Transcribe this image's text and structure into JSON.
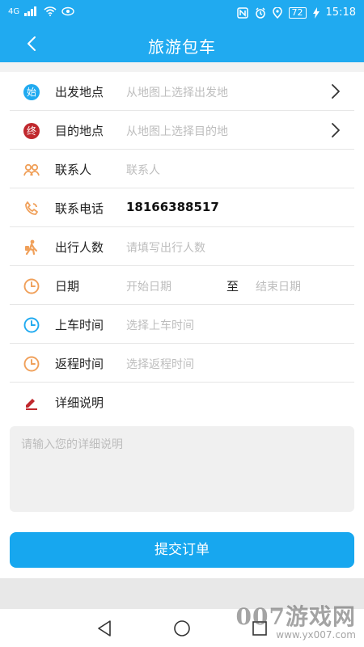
{
  "status_bar": {
    "left_text": "4G",
    "battery": "72",
    "time": "15:18"
  },
  "header": {
    "title": "旅游包车"
  },
  "form": {
    "rows": [
      {
        "label": "出发地点",
        "value": "从地图上选择出发地",
        "icon": "start-badge-icon",
        "icon_text": "始",
        "icon_color": "#20aaf0"
      },
      {
        "label": "目的地点",
        "value": "从地图上选择目的地",
        "icon": "end-badge-icon",
        "icon_text": "终",
        "icon_color": "#c0282d"
      },
      {
        "label": "联系人",
        "value": "联系人",
        "icon": "contacts-icon"
      },
      {
        "label": "联系电话",
        "value": "18166388517",
        "icon": "phone-icon"
      },
      {
        "label": "出行人数",
        "value": "请填写出行人数",
        "icon": "traveler-icon"
      },
      {
        "label": "日期",
        "start": "开始日期",
        "to": "至",
        "end": "结束日期",
        "icon": "clock-icon"
      },
      {
        "label": "上车时间",
        "value": "选择上车时间",
        "icon": "clock-icon"
      },
      {
        "label": "返程时间",
        "value": "选择返程时间",
        "icon": "clock-icon"
      },
      {
        "label": "详细说明",
        "icon": "pen-icon"
      }
    ],
    "details_placeholder": "请输入您的详细说明",
    "submit_label": "提交订单"
  },
  "watermark": {
    "brand": "007游戏网",
    "url": "www.yx007.com"
  },
  "colors": {
    "primary": "#20aaf0",
    "submit": "#17a7ef",
    "orange": "#f0a05a",
    "red": "#c0282d"
  }
}
